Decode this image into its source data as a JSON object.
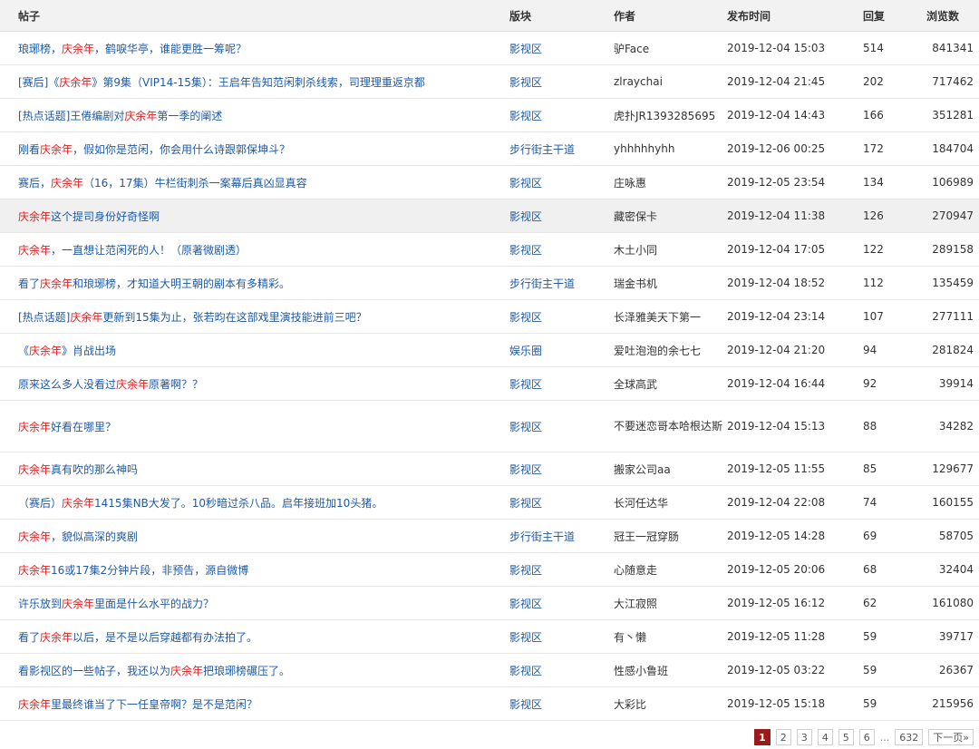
{
  "columns": {
    "title": "帖子",
    "board": "版块",
    "author": "作者",
    "time": "发布时间",
    "replies": "回复",
    "views": "浏览数"
  },
  "rows": [
    {
      "title_parts": [
        {
          "t": "琅琊榜，",
          "kw": false
        },
        {
          "t": "庆余年",
          "kw": true
        },
        {
          "t": "，鹤唳华亭，谁能更胜一筹呢？",
          "kw": false
        }
      ],
      "board": "影视区",
      "author": "驴Face",
      "time": "2019-12-04 15:03",
      "replies": "514",
      "views": "841341"
    },
    {
      "title_parts": [
        {
          "t": "[赛后]《",
          "kw": false
        },
        {
          "t": "庆余年",
          "kw": true
        },
        {
          "t": "》第9集（VIP14-15集）：王启年告知范闲刺杀线索，司理理重返京都",
          "kw": false
        }
      ],
      "board": "影视区",
      "author": "zlraychai",
      "time": "2019-12-04 21:45",
      "replies": "202",
      "views": "717462"
    },
    {
      "title_parts": [
        {
          "t": "[热点话题]王倦编剧对",
          "kw": false
        },
        {
          "t": "庆余年",
          "kw": true
        },
        {
          "t": "第一季的阐述",
          "kw": false
        }
      ],
      "board": "影视区",
      "author": "虎扑JR1393285695",
      "time": "2019-12-04 14:43",
      "replies": "166",
      "views": "351281"
    },
    {
      "title_parts": [
        {
          "t": "刚看",
          "kw": false
        },
        {
          "t": "庆余年",
          "kw": true
        },
        {
          "t": "，假如你是范闲，你会用什么诗跟郭保坤斗？",
          "kw": false
        }
      ],
      "board": "步行街主干道",
      "author": "yhhhhhyhh",
      "time": "2019-12-06 00:25",
      "replies": "172",
      "views": "184704"
    },
    {
      "title_parts": [
        {
          "t": "赛后，",
          "kw": false
        },
        {
          "t": "庆余年",
          "kw": true
        },
        {
          "t": "（16，17集）牛栏街刺杀一案幕后真凶显真容",
          "kw": false
        }
      ],
      "board": "影视区",
      "author": "庄咏惠",
      "time": "2019-12-05 23:54",
      "replies": "134",
      "views": "106989"
    },
    {
      "title_parts": [
        {
          "t": "庆余年",
          "kw": true
        },
        {
          "t": "这个提司身份好奇怪啊",
          "kw": false
        }
      ],
      "board": "影视区",
      "author": "藏密保卡",
      "time": "2019-12-04 11:38",
      "replies": "126",
      "views": "270947",
      "highlight": true
    },
    {
      "title_parts": [
        {
          "t": "庆余年",
          "kw": true
        },
        {
          "t": "，一直想让范闲死的人！（原著微剧透）",
          "kw": false
        }
      ],
      "board": "影视区",
      "author": "木土小同",
      "time": "2019-12-04 17:05",
      "replies": "122",
      "views": "289158"
    },
    {
      "title_parts": [
        {
          "t": "看了",
          "kw": false
        },
        {
          "t": "庆余年",
          "kw": true
        },
        {
          "t": "和琅琊榜，才知道大明王朝的剧本有多精彩。",
          "kw": false
        }
      ],
      "board": "步行街主干道",
      "author": "瑞金书机",
      "time": "2019-12-04 18:52",
      "replies": "112",
      "views": "135459"
    },
    {
      "title_parts": [
        {
          "t": "[热点话题]",
          "kw": false
        },
        {
          "t": "庆余年",
          "kw": true
        },
        {
          "t": "更新到15集为止，张若昀在这部戏里演技能进前三吧？",
          "kw": false
        }
      ],
      "board": "影视区",
      "author": "长泽雅美天下第一",
      "time": "2019-12-04 23:14",
      "replies": "107",
      "views": "277111"
    },
    {
      "title_parts": [
        {
          "t": "《",
          "kw": false
        },
        {
          "t": "庆余年",
          "kw": true
        },
        {
          "t": "》肖战出场",
          "kw": false
        }
      ],
      "board": "娱乐圈",
      "author": "爱吐泡泡的余七七",
      "time": "2019-12-04 21:20",
      "replies": "94",
      "views": "281824"
    },
    {
      "title_parts": [
        {
          "t": "原来这么多人没看过",
          "kw": false
        },
        {
          "t": "庆余年",
          "kw": true
        },
        {
          "t": "原著啊？？",
          "kw": false
        }
      ],
      "board": "影视区",
      "author": "全球高武",
      "time": "2019-12-04 16:44",
      "replies": "92",
      "views": "39914"
    },
    {
      "title_parts": [
        {
          "t": "庆余年",
          "kw": true
        },
        {
          "t": "好看在哪里？",
          "kw": false
        }
      ],
      "board": "影视区",
      "author": "不要迷恋哥本哈根达斯",
      "time": "2019-12-04 15:13",
      "replies": "88",
      "views": "34282",
      "tall": true
    },
    {
      "title_parts": [
        {
          "t": "庆余年",
          "kw": true
        },
        {
          "t": "真有吹的那么神吗",
          "kw": false
        }
      ],
      "board": "影视区",
      "author": "搬家公司aa",
      "time": "2019-12-05 11:55",
      "replies": "85",
      "views": "129677"
    },
    {
      "title_parts": [
        {
          "t": "（赛后）",
          "kw": false
        },
        {
          "t": "庆余年",
          "kw": true
        },
        {
          "t": "1415集NB大发了。10秒暗过杀八品。启年接班加10头猪。",
          "kw": false
        }
      ],
      "board": "影视区",
      "author": "长河任达华",
      "time": "2019-12-04 22:08",
      "replies": "74",
      "views": "160155"
    },
    {
      "title_parts": [
        {
          "t": "庆余年",
          "kw": true
        },
        {
          "t": "，貌似高深的爽剧",
          "kw": false
        }
      ],
      "board": "步行街主干道",
      "author": "冠王一冠穿肠",
      "time": "2019-12-05 14:28",
      "replies": "69",
      "views": "58705"
    },
    {
      "title_parts": [
        {
          "t": "庆余年",
          "kw": true
        },
        {
          "t": "16或17集2分钟片段，非预告，源自微博",
          "kw": false
        }
      ],
      "board": "影视区",
      "author": "心随意走",
      "time": "2019-12-05 20:06",
      "replies": "68",
      "views": "32404"
    },
    {
      "title_parts": [
        {
          "t": "许乐放到",
          "kw": false
        },
        {
          "t": "庆余年",
          "kw": true
        },
        {
          "t": "里面是什么水平的战力？",
          "kw": false
        }
      ],
      "board": "影视区",
      "author": "大江寂照",
      "time": "2019-12-05 16:12",
      "replies": "62",
      "views": "161080"
    },
    {
      "title_parts": [
        {
          "t": "看了",
          "kw": false
        },
        {
          "t": "庆余年",
          "kw": true
        },
        {
          "t": "以后，是不是以后穿越都有办法拍了。",
          "kw": false
        }
      ],
      "board": "影视区",
      "author": "有丶懒",
      "time": "2019-12-05 11:28",
      "replies": "59",
      "views": "39717"
    },
    {
      "title_parts": [
        {
          "t": "看影视区的一些帖子，我还以为",
          "kw": false
        },
        {
          "t": "庆余年",
          "kw": true
        },
        {
          "t": "把琅琊榜碾压了。",
          "kw": false
        }
      ],
      "board": "影视区",
      "author": "性感小鲁班",
      "time": "2019-12-05 03:22",
      "replies": "59",
      "views": "26367"
    },
    {
      "title_parts": [
        {
          "t": "庆余年",
          "kw": true
        },
        {
          "t": "里最终谁当了下一任皇帝啊？是不是范闲？",
          "kw": false
        }
      ],
      "board": "影视区",
      "author": "大彩比",
      "time": "2019-12-05 15:18",
      "replies": "59",
      "views": "215956"
    }
  ],
  "pager": {
    "pages": [
      "1",
      "2",
      "3",
      "4",
      "5",
      "6"
    ],
    "active": "1",
    "ellipsis": "...",
    "last": "632",
    "next": "下一页»"
  },
  "colors": {
    "keyword": "#e11f1f",
    "link": "#1f5aa6",
    "pager_active": "#9b1a1a",
    "header_bg": "#f2f2f2"
  }
}
